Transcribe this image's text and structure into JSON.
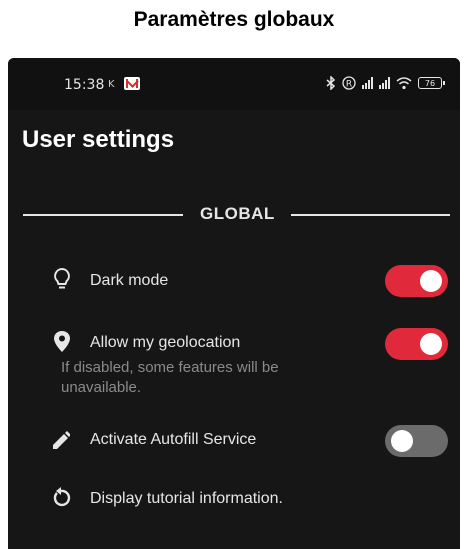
{
  "caption": "Paramètres globaux",
  "status_bar": {
    "time": "15:38",
    "small_k": "K",
    "battery": "76"
  },
  "page": {
    "title": "User settings"
  },
  "section": {
    "label": "GLOBAL"
  },
  "settings": [
    {
      "icon": "lightbulb-icon",
      "label": "Dark mode",
      "toggle": "on"
    },
    {
      "icon": "location-pin-icon",
      "label": "Allow my geolocation",
      "description": "If disabled, some features will be unavailable.",
      "toggle": "on"
    },
    {
      "icon": "pencil-icon",
      "label": "Activate Autofill Service",
      "toggle": "off"
    },
    {
      "icon": "refresh-icon",
      "label": "Display tutorial information."
    }
  ],
  "colors": {
    "background": "#161616",
    "toggle_on": "#e02a3b",
    "toggle_off": "#6b6b6b",
    "text": "#e6e6e6",
    "muted": "#8a8a8a"
  }
}
